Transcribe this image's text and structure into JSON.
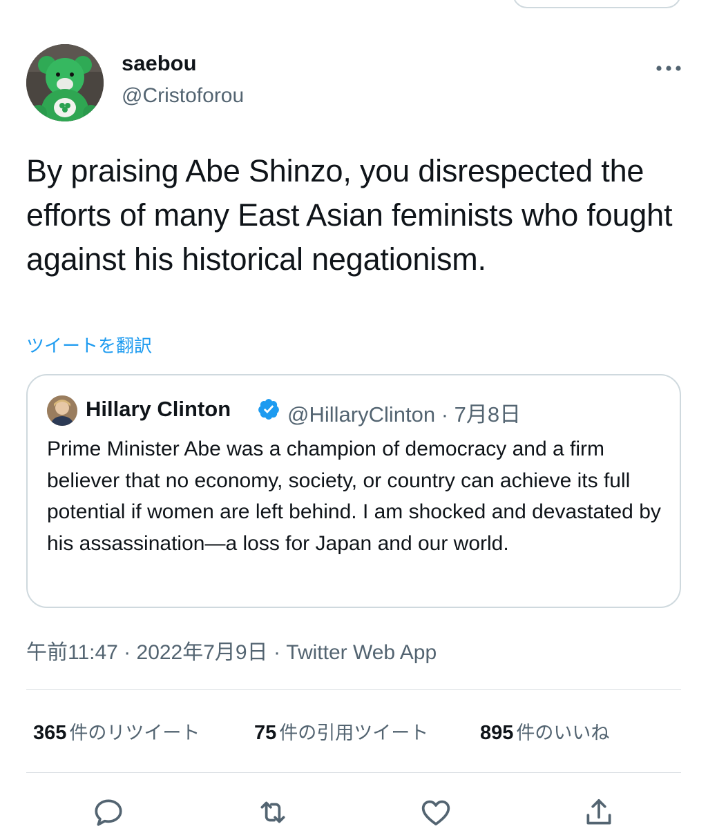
{
  "tweet": {
    "author_name": "saebou",
    "author_handle": "@Cristoforou",
    "text": "By praising Abe Shinzo, you disrespected the efforts of many East Asian feminists who fought against his historical negationism.",
    "translate_label": "ツイートを翻訳",
    "timestamp": "午前11:47 · 2022年7月9日 · Twitter Web App"
  },
  "quoted": {
    "author_name": "Hillary Clinton",
    "meta": "@HillaryClinton · 7月8日",
    "text": "Prime Minister Abe was a champion of democracy and a firm believer that no economy, society, or country can achieve its full potential if women are left behind. I am shocked and devastated by his assassination—a loss for Japan and our world."
  },
  "stats": {
    "retweets_count": "365",
    "retweets_label": "件のリツイート",
    "quotes_count": "75",
    "quotes_label": "件の引用ツイート",
    "likes_count": "895",
    "likes_label": "件のいいね"
  },
  "icons": {
    "more": "more-icon",
    "verified": "verified-badge-icon",
    "reply": "reply-icon",
    "retweet": "retweet-icon",
    "like": "like-icon",
    "share": "share-icon"
  },
  "colors": {
    "accent": "#1d9bf0",
    "secondary_text": "#536471",
    "border": "#cfd9de",
    "icon": "#536471"
  }
}
